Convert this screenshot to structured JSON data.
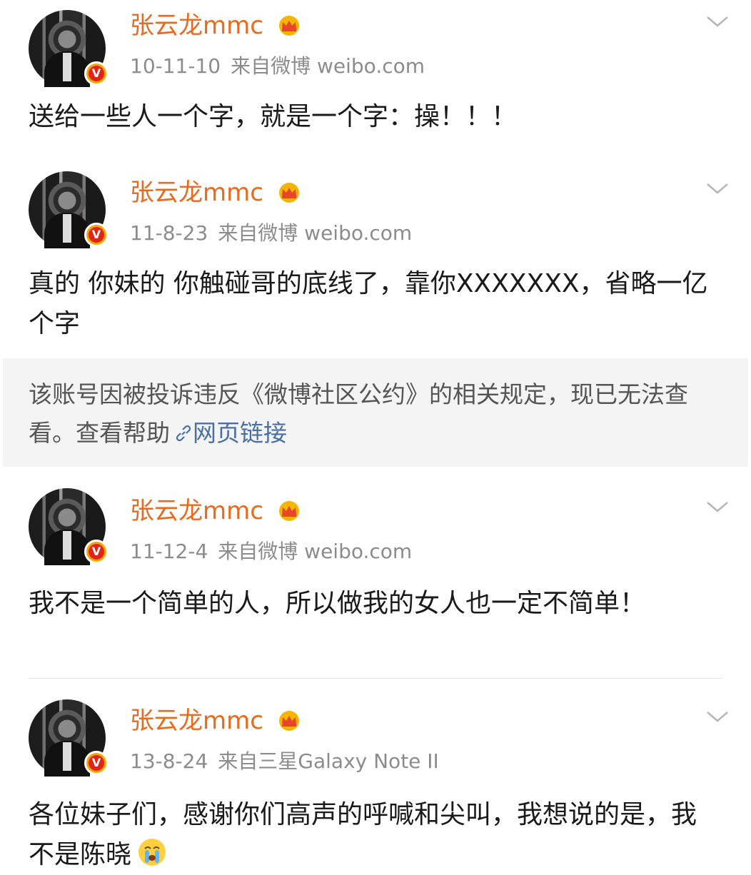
{
  "posts": [
    {
      "username": "张云龙mmc",
      "date": "10-11-10",
      "source": "来自微博 weibo.com",
      "text": "送给一些人一个字，就是一个字：操！！！"
    },
    {
      "username": "张云龙mmc",
      "date": "11-8-23",
      "source": "来自微博 weibo.com",
      "text": "真的  你妹的 你触碰哥的底线了，靠你XXXXXXX，省略一亿个字"
    },
    {
      "username": "张云龙mmc",
      "date": "11-12-4",
      "source": "来自微博 weibo.com",
      "text": "我不是一个简单的人，所以做我的女人也一定不简单！"
    },
    {
      "username": "张云龙mmc",
      "date": "13-8-24",
      "source": "来自三星Galaxy Note II",
      "text": "各位妹子们，感谢你们高声的呼喊和尖叫，我想说的是，我不是陈晓"
    }
  ],
  "notice": {
    "text": "该账号因被投诉违反《微博社区公约》的相关规定，现已无法查看。查看帮助",
    "link_label": "网页链接"
  },
  "verified_badge_letter": "V",
  "icons": {
    "crown": "crown-icon",
    "chevron": "chevron-down-icon",
    "link": "link-icon",
    "emoji": "crying-emoji-icon"
  },
  "colors": {
    "username": "#e86a1f",
    "meta": "#8c8c8c",
    "link": "#4a6fa5",
    "notice_bg": "#f4f4f4",
    "badge_outer": "#f5a800",
    "badge_inner": "#e2231a"
  }
}
